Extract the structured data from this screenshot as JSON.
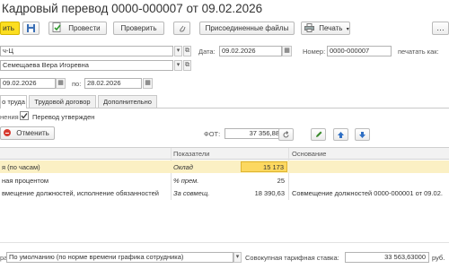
{
  "window": {
    "title": "Кадровый перевод 0000-000007 от 09.02.2026"
  },
  "toolbar": {
    "post_close_label": "ить",
    "post_label": "Провести",
    "check_label": "Проверить",
    "attached_files_label": "Присоединенные файлы",
    "print_label": "Печать"
  },
  "header": {
    "org_value": "ч-Ц",
    "date_label": "Дата:",
    "date_value": "09.02.2026",
    "number_label": "Номер:",
    "number_value": "0000-000007",
    "print_as_label": "печатать как:",
    "employee_value": "Семещаева Вера Игоревна",
    "period_from_value": "09.02.2026",
    "period_to_label": "по:",
    "period_to_value": "28.02.2026"
  },
  "tabs": [
    {
      "label": "о труда"
    },
    {
      "label": "Трудовой договор"
    },
    {
      "label": "Дополнительно"
    }
  ],
  "panel": {
    "changes_label": "нения",
    "transfer_approved_label": "Перевод утвержден",
    "cancel_label": "Отменить",
    "fot_label": "ФОТ:",
    "fot_value": "37 356,88"
  },
  "table": {
    "columns": [
      "Показатели",
      "Основание"
    ],
    "rows": [
      {
        "name": "я (по часам)",
        "indicator": "Оклад",
        "value": "15 173",
        "basis": ""
      },
      {
        "name": "ная процентом",
        "indicator": "% прем.",
        "value": "25",
        "basis": ""
      },
      {
        "name": "вмещение должностей, исполнение обязанностей",
        "indicator": "За совмещ.",
        "value": "18 390,63",
        "basis": "Совмещение должностей 0000-000001 от 09.02."
      }
    ]
  },
  "footer": {
    "calc_label": "расч:",
    "calc_value": "По умолчанию (по норме времени графика сотрудника)",
    "rate_label": "Совокупная тарифная ставка:",
    "rate_value": "33 563,63000",
    "currency": "руб."
  },
  "colors": {
    "primary_button": "#fcde20",
    "selected_row": "#fbf0c4",
    "active_cell": "#fcd860",
    "icon_green": "#3a8a2c",
    "icon_blue": "#2f6fc4",
    "cancel_red": "#d63a2f"
  }
}
